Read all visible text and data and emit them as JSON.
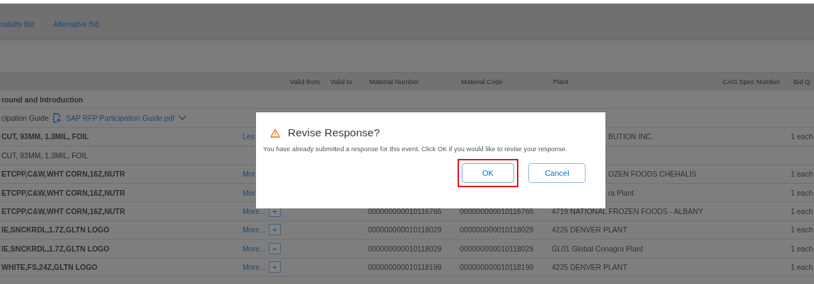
{
  "tabs": [
    {
      "label": "nability Bid"
    },
    {
      "label": "Alternative Bid"
    }
  ],
  "table": {
    "columns": [
      "Valid from",
      "Valid to",
      "Material Number",
      "Material Code",
      "Plant",
      "CAG Spec Number",
      "Bid Q"
    ],
    "rows": [
      {
        "kind": "section",
        "description": "round and Introduction"
      },
      {
        "kind": "attachment",
        "description": "cipation Guide",
        "file": "SAP RFP Participation Guide.pdf"
      },
      {
        "kind": "item",
        "description": "CUT, 93MM, 1.3MIL, FOIL",
        "bold": true,
        "link": "Les",
        "under_dialog": true,
        "plant": "BUTION INC.",
        "quantity": "1 each"
      },
      {
        "kind": "item",
        "description": "CUT, 93MM, 1.3MIL, FOIL",
        "bold": false
      },
      {
        "kind": "item",
        "description": "ETCPP,C&W,WHT CORN,16Z,NUTR",
        "bold": true,
        "link": "Mor",
        "under_dialog": true,
        "plant": "OZEN FOODS CHEHALIS",
        "quantity": "1 each"
      },
      {
        "kind": "item",
        "description": "ETCPP,C&W,WHT CORN,16Z,NUTR",
        "bold": true,
        "link": "Mor",
        "under_dialog": true,
        "plant": "ra Plant",
        "quantity": "1 each"
      },
      {
        "kind": "item",
        "description": "ETCPP,C&W,WHT CORN,16Z,NUTR",
        "bold": true,
        "link": "More...",
        "expand": "+",
        "under_dialog": false,
        "material_number": "000000000010116765",
        "material_code": "000000000010116765",
        "plant": "4719 NATIONAL FROZEN FOODS - ALBANY",
        "quantity": "1 each"
      },
      {
        "kind": "item",
        "description": "IE,SNCKRDL,1.7Z,GLTN LOGO",
        "bold": true,
        "link": "More...",
        "expand": "+",
        "under_dialog": false,
        "material_number": "000000000010118029",
        "material_code": "000000000010118029",
        "plant": "4225 DENVER PLANT",
        "quantity": "1 each"
      },
      {
        "kind": "item",
        "description": "IE,SNCKRDL,1.7Z,GLTN LOGO",
        "bold": true,
        "link": "More...",
        "expand": "+",
        "under_dialog": false,
        "material_number": "000000000010118029",
        "material_code": "000000000010118029",
        "plant": "GL01 Global Conagra Plant",
        "quantity": "1 each"
      },
      {
        "kind": "item",
        "description": "WHITE,FS,24Z,GLTN LOGO",
        "bold": true,
        "link": "More...",
        "expand": "+",
        "under_dialog": false,
        "material_number": "000000000010118199",
        "material_code": "000000000010118199",
        "plant": "4225 DENVER PLANT",
        "quantity": "1 each"
      }
    ]
  },
  "dialog": {
    "title": "Revise Response?",
    "message": "You have already submitted a response for this event. Click OK if you would like to revise your response.",
    "buttons": [
      {
        "label": "OK",
        "kind": "primary",
        "highlighted": true
      },
      {
        "label": "Cancel",
        "kind": "secondary",
        "highlighted": false
      }
    ]
  }
}
